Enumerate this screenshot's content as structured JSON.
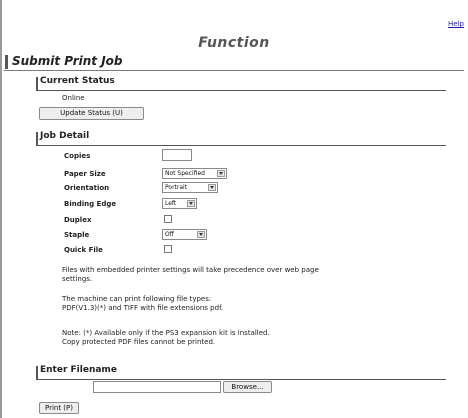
{
  "header": {
    "help_link": "Help",
    "function_title": "Function",
    "page_title": "Submit Print Job"
  },
  "current_status": {
    "title": "Current Status",
    "status_text": "Online",
    "update_button": "Update Status (U)"
  },
  "job_detail": {
    "title": "Job Detail",
    "copies_label": "Copies",
    "copies_value": "",
    "paper_size_label": "Paper Size",
    "paper_size_value": "Not Specified",
    "orientation_label": "Orientation",
    "orientation_value": "Portrait",
    "binding_edge_label": "Binding Edge",
    "binding_edge_value": "Left",
    "duplex_label": "Duplex",
    "duplex_checked": false,
    "staple_label": "Staple",
    "staple_value": "Off",
    "quick_file_label": "Quick File",
    "quick_file_checked": false,
    "note_precedence": "Files with embedded printer settings will take precedence over web page\nsettings.",
    "note_filetypes": "The machine can print following file types:\nPDF(V1.3)(*) and TIFF with file extensions pdf.",
    "note_ps3": "Note: (*) Available only if the PS3 expansion kit is installed.\nCopy protected PDF files cannot be printed."
  },
  "enter_filename": {
    "title": "Enter Filename",
    "filename_value": "",
    "browse_button": "Browse...",
    "print_button": "Print (P)"
  },
  "colors": {
    "link": "#1a1aa6",
    "section_rule": "#555555",
    "button_bg": "#eeeeee"
  }
}
